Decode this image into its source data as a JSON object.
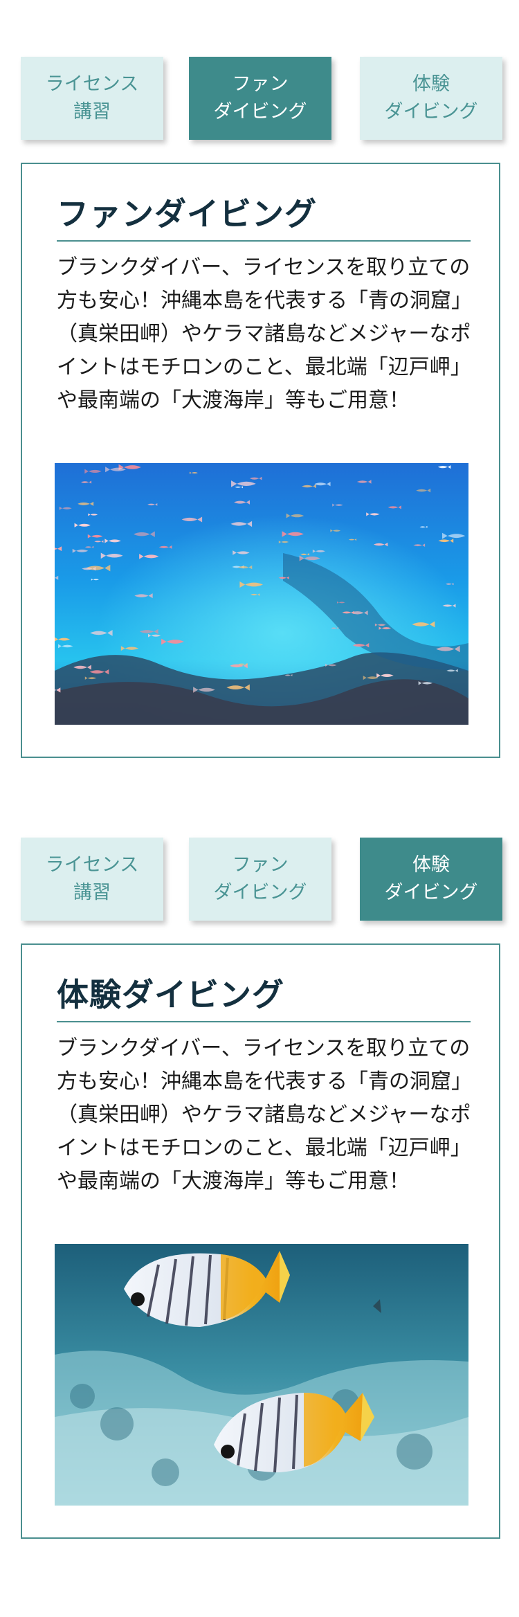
{
  "sections": [
    {
      "tabs": [
        {
          "line1": "ライセンス",
          "line2": "講習",
          "active": false
        },
        {
          "line1": "ファン",
          "line2": "ダイビング",
          "active": true
        },
        {
          "line1": "体験",
          "line2": "ダイビング",
          "active": false
        }
      ],
      "title": "ファンダイビング",
      "body": "ブランクダイバー、ライセンスを取り立ての方も安心！沖縄本島を代表する「青の洞窟」（真栄田岬）やケラマ諸島などメジャーなポイントはモチロンのこと、最北端「辺戸岬」や最南端の「大渡海岸」等もご用意！",
      "image": "reef-fish-school-photo"
    },
    {
      "tabs": [
        {
          "line1": "ライセンス",
          "line2": "講習",
          "active": false
        },
        {
          "line1": "ファン",
          "line2": "ダイビング",
          "active": false
        },
        {
          "line1": "体験",
          "line2": "ダイビング",
          "active": true
        }
      ],
      "title": "体験ダイビング",
      "body": "ブランクダイバー、ライセンスを取り立ての方も安心！沖縄本島を代表する「青の洞窟」（真栄田岬）やケラマ諸島などメジャーなポイントはモチロンのこと、最北端「辺戸岬」や最南端の「大渡海岸」等もご用意！",
      "image": "butterflyfish-photo"
    }
  ],
  "colors": {
    "tab_inactive_bg": "#dcefef",
    "tab_inactive_text": "#4a9494",
    "tab_active_bg": "#3e8b8b",
    "tab_active_text": "#ffffff",
    "card_border": "#4a8f8f",
    "title_text": "#14303f"
  }
}
